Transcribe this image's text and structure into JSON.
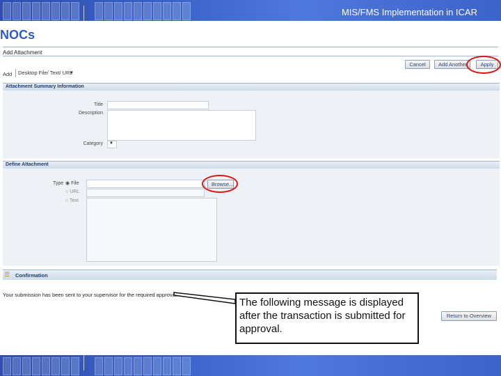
{
  "slide": {
    "header_title": "MIS/FMS Implementation in ICAR",
    "title": "NOCs"
  },
  "app": {
    "page_label": "Add Attachment",
    "buttons": {
      "cancel": "Cancel",
      "add_another": "Add Another",
      "apply": "Apply",
      "browse": "Browse...",
      "return_to_overview": "Return to Overview"
    },
    "add": {
      "label": "Add",
      "selected": "Desktop File/ Text/ URL"
    },
    "summary_section": {
      "title": "Attachment Summary Information",
      "fields": {
        "title_label": "Title",
        "description_label": "Description",
        "category_label": "Category"
      }
    },
    "define_section": {
      "title": "Define Attachment",
      "type_label": "Type",
      "options": [
        "File",
        "URL",
        "Text"
      ],
      "selected_option": "File"
    },
    "confirmation": {
      "title": "Confirmation",
      "message": "Your submission has been sent to your supervisor for the required approval."
    }
  },
  "callout": {
    "text": "The following message is displayed after the transaction is submitted for approval."
  },
  "colors": {
    "banner": "#3b63c9",
    "title": "#2f5cc4",
    "highlight": "#e01515",
    "section_bg": "#eef2f7"
  }
}
